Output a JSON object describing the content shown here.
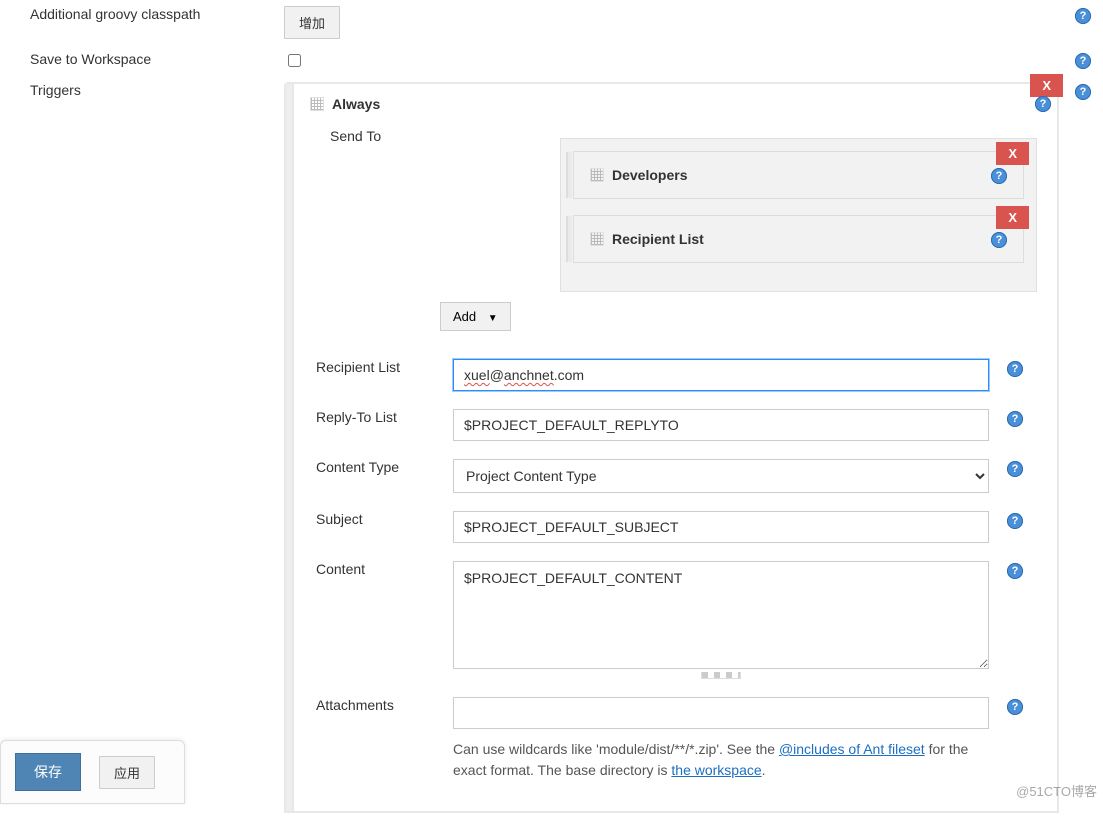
{
  "rows": {
    "classpath_label": "Additional groovy classpath",
    "classpath_add_btn": "增加",
    "save_ws_label": "Save to Workspace",
    "triggers_label": "Triggers"
  },
  "trigger": {
    "title": "Always",
    "sendto_label": "Send To",
    "items": [
      {
        "label": "Developers"
      },
      {
        "label": "Recipient List"
      }
    ],
    "add_label": "Add",
    "remove_label": "X"
  },
  "fields": {
    "recipient_list_label": "Recipient List",
    "recipient_list_value": "xuel@anchnet.com",
    "recipient_list_squiggle1": "xuel",
    "recipient_list_squiggle2": "anchnet",
    "recipient_list_rest": ".com",
    "reply_to_label": "Reply-To List",
    "reply_to_value": "$PROJECT_DEFAULT_REPLYTO",
    "content_type_label": "Content Type",
    "content_type_value": "Project Content Type",
    "subject_label": "Subject",
    "subject_value": "$PROJECT_DEFAULT_SUBJECT",
    "content_label": "Content",
    "content_value": "$PROJECT_DEFAULT_CONTENT",
    "attachments_label": "Attachments",
    "attachments_value": ""
  },
  "note": {
    "pre": "Can use wildcards like 'module/dist/**/*.zip'. See the ",
    "link1": "@includes of Ant fileset",
    "mid": " for the exact format. The base directory is ",
    "link2": "the workspace",
    "post": "."
  },
  "bottom": {
    "save": "保存",
    "apply": "应用"
  },
  "watermark": "@51CTO博客",
  "help_glyph": "?"
}
